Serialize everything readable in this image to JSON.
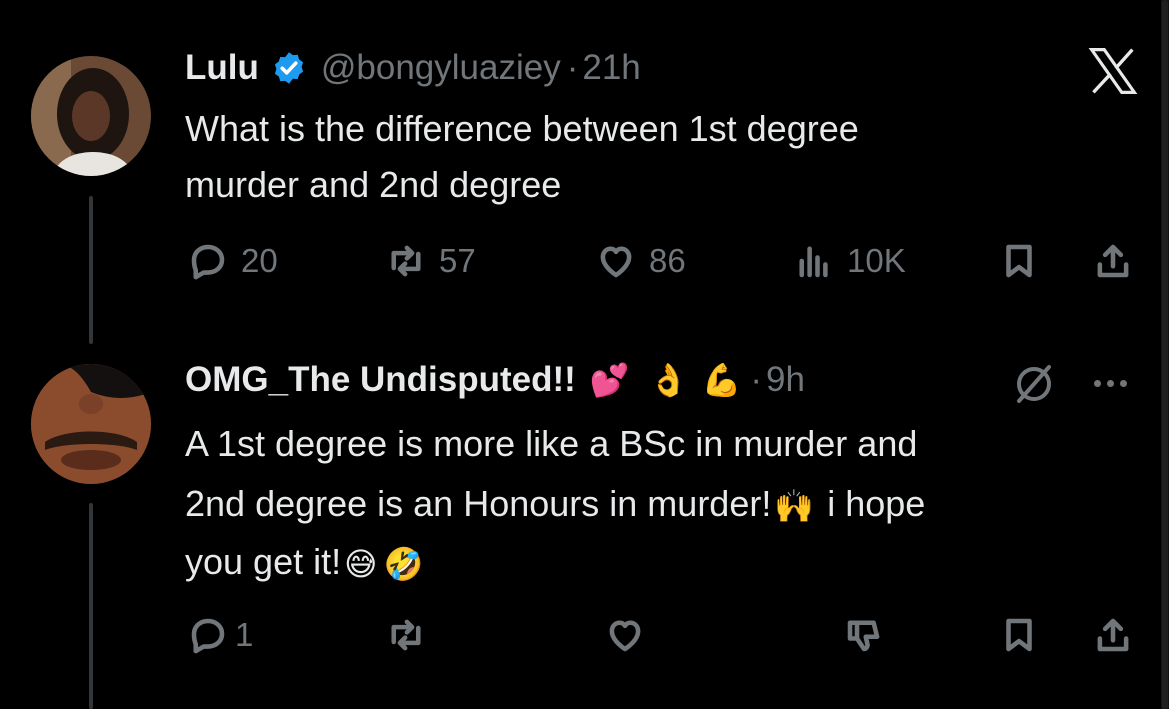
{
  "tweet": {
    "name": "Lulu",
    "handle": "@bongyluaziey",
    "separator": "·",
    "time": "21h",
    "line1": "What is the difference between 1st degree",
    "line2": "murder and 2nd degree",
    "replies": "20",
    "retweets": "57",
    "likes": "86",
    "views": "10K"
  },
  "reply": {
    "name": "OMG_The Undisputed!!",
    "name_emojis": [
      "💕",
      "👌",
      "💪"
    ],
    "separator": "·",
    "time": "9h",
    "line1": "A 1st degree is more like a BSc in murder and",
    "line2_a": "2nd degree is an Honours in murder!",
    "line2_emoji": "🙌",
    "line2_b": " i hope",
    "line3": "you get it!",
    "line3_emojis": [
      "😅",
      "🤣"
    ],
    "replies": "1"
  },
  "colors": {
    "background": "#000000",
    "text": "#e7e9ea",
    "muted": "#71767b",
    "verified": "#1d9bf0",
    "thread_line": "#333639"
  },
  "icons": [
    "x-logo-icon",
    "verified-badge-icon",
    "reply-icon",
    "retweet-icon",
    "like-icon",
    "views-icon",
    "bookmark-icon",
    "share-icon",
    "grok-icon",
    "more-icon",
    "dislike-icon"
  ]
}
